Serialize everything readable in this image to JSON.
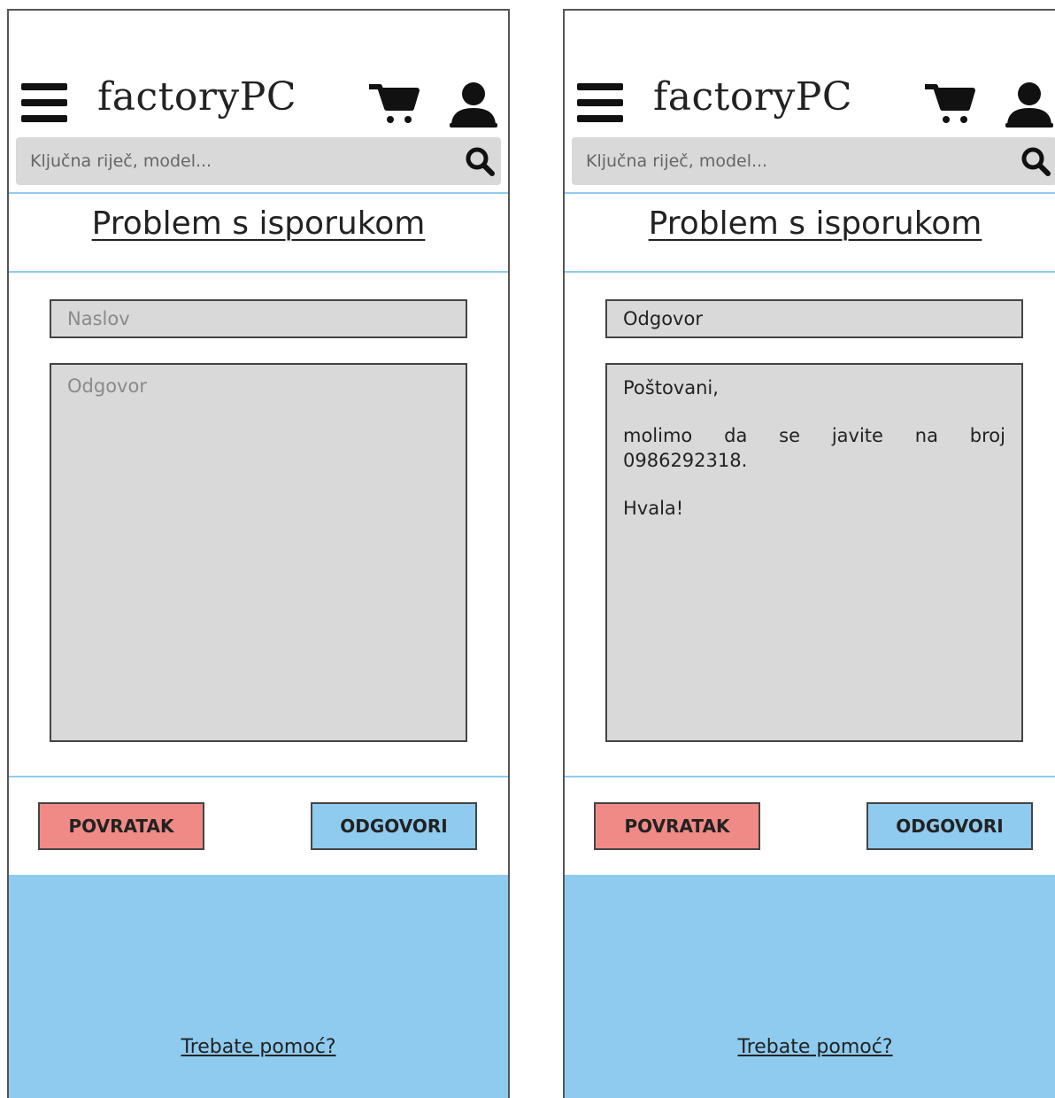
{
  "brand": {
    "logo_text": "factoryPC"
  },
  "search": {
    "placeholder": "Ključna riječ, model..."
  },
  "page": {
    "title": "Problem s isporukom"
  },
  "screens": [
    {
      "subject_placeholder": "Naslov",
      "message_placeholder": "Odgovor"
    },
    {
      "subject_value": "Odgovor",
      "message_lines": {
        "greeting": "Poštovani,",
        "body": "molimo da se javite na broj 0986292318.",
        "closing": "Hvala!"
      }
    }
  ],
  "buttons": {
    "back": "POVRATAK",
    "reply": "ODGOVORI"
  },
  "footer": {
    "help_link": "Trebate pomoć?"
  },
  "icons": [
    "menu-icon",
    "cart-icon",
    "user-icon",
    "search-icon"
  ],
  "colors": {
    "accent_blue": "#8ecbef",
    "back_red": "#f08a86",
    "field_gray": "#d9d9d9"
  }
}
